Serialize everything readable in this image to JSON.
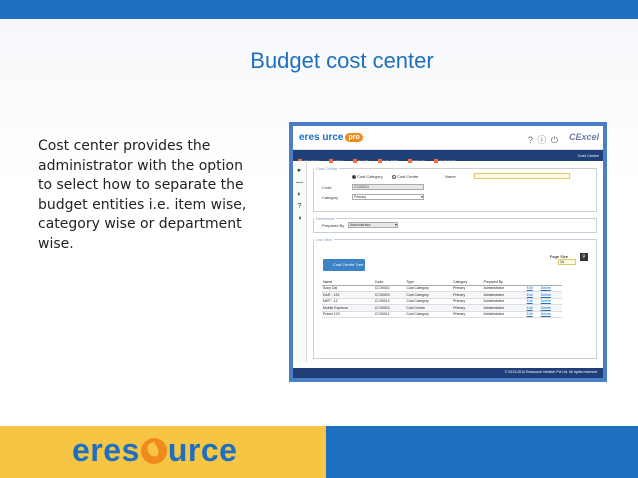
{
  "slide": {
    "title": "Budget cost center",
    "body": "Cost center provides the administrator with the option to select how to separate the budget entities i.e. item wise, category wise or department wise.",
    "footer_logo_pre": "eres",
    "footer_logo_post": "urce"
  },
  "app": {
    "logo_text": "eres urce",
    "logo_badge": "pro",
    "header_icons": "? ⓘ ⏻",
    "brand": "CExcel",
    "toolbar": [
      "SEARCH",
      "NEW",
      "SAVE",
      "DELETE",
      "PRINT",
      "EXPORT"
    ],
    "toolbar_right": "Cost Centre",
    "side_icons": [
      "▸",
      "—",
      "◐",
      "?",
      "◑"
    ],
    "cost_centre_legend": "Cost Centre",
    "radio_category": "Cost Category",
    "radio_centre": "Cost Centre",
    "name_label": "Name",
    "code_label": "Code",
    "code_value": "CC00010",
    "category_label": "Category",
    "category_value": "Primary",
    "reference_legend": "Reference",
    "prepared_by_label": "Prepared By",
    "prepared_by_value": "Administrator",
    "list_legend": "List View",
    "cost_centre_tree": "Cost Centre Tree",
    "page_size_label": "Page Size",
    "page_size_value": "10",
    "columns": [
      "Name",
      "Code",
      "Type",
      "Category",
      "Prepared By",
      "",
      ""
    ],
    "rows": [
      [
        "Sony Dai",
        "CC00010",
        "Cost Category",
        "Primary",
        "Administrator",
        "Edit",
        "Delete"
      ],
      [
        "DAR - 123",
        "CC00003",
        "Cost Category",
        "Primary",
        "Administrator",
        "Edit",
        "Delete"
      ],
      [
        "MKP - 12",
        "CC00013",
        "Cost Category",
        "Primary",
        "Administrator",
        "Edit",
        "Delete"
      ],
      [
        "Mobile Expense",
        "CC00003",
        "Cost Centre",
        "Primary",
        "Administrator",
        "Edit",
        "Delete"
      ],
      [
        "Pravin 123",
        "CC00012",
        "Cost Category",
        "Primary",
        "Administrator",
        "Edit",
        "Delete"
      ]
    ],
    "footer": "© 2013-2014 Eresource Infotech Pvt Ltd. All rights reserved"
  }
}
